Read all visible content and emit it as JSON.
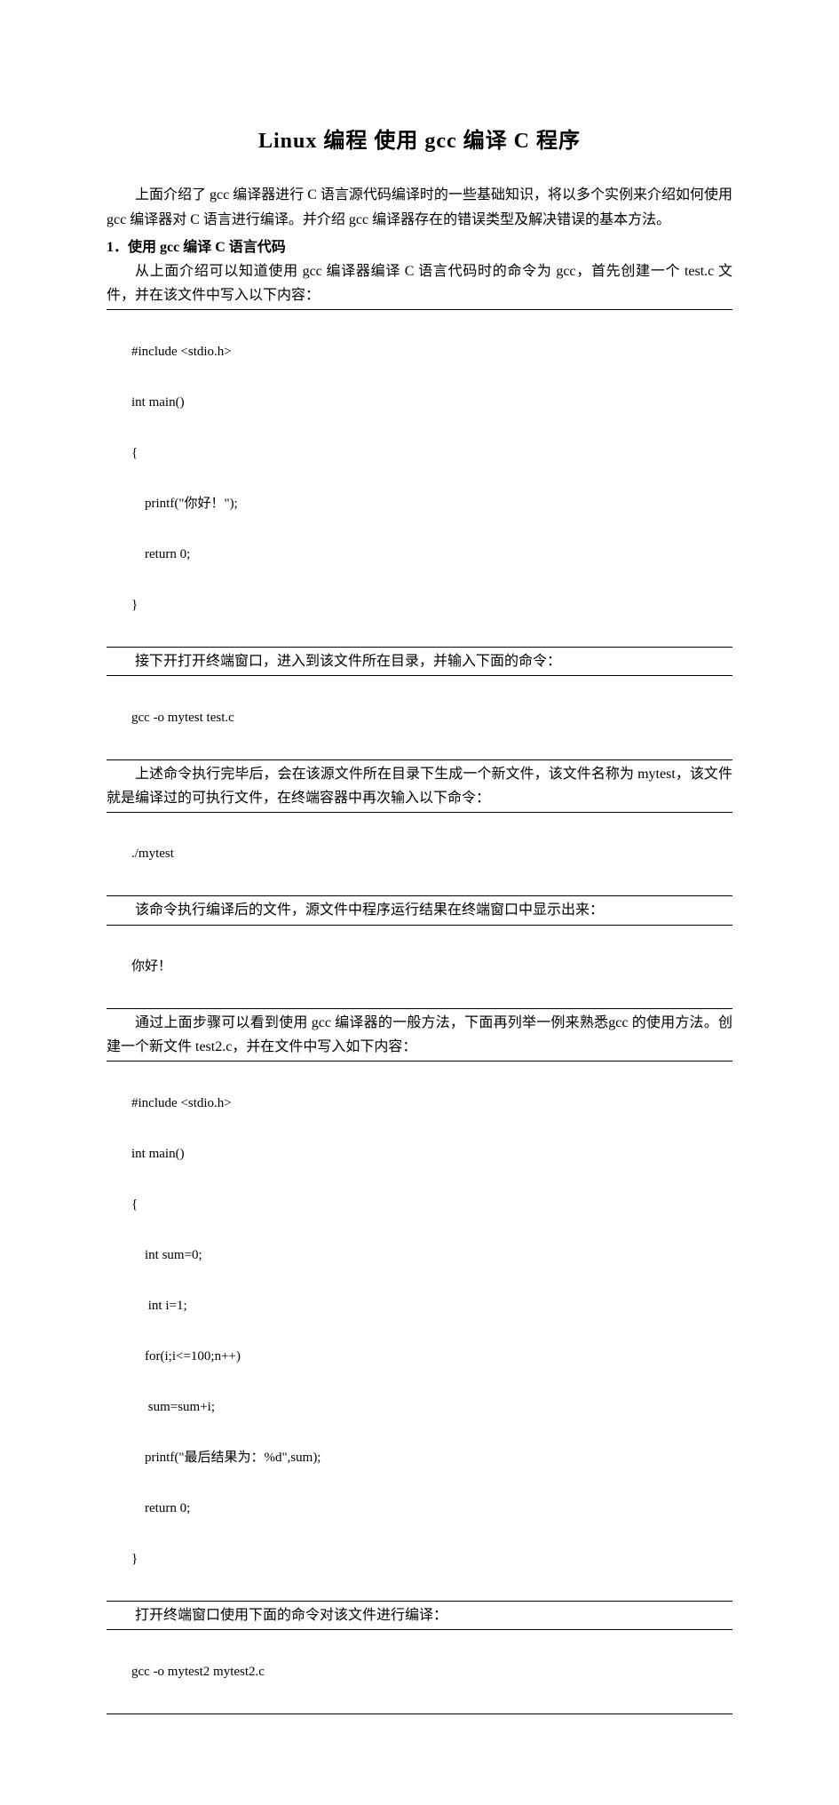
{
  "title": "Linux 编程   使用 gcc 编译 C 程序",
  "intro": "上面介绍了 gcc 编译器进行 C 语言源代码编译时的一些基础知识，将以多个实例来介绍如何使用 gcc 编译器对 C 语言进行编译。并介绍 gcc 编译器存在的错误类型及解决错误的基本方法。",
  "section1_heading": "1．使用 gcc 编译 C 语言代码",
  "section1_p1": "从上面介绍可以知道使用 gcc 编译器编译 C 语言代码时的命令为 gcc，首先创建一个 test.c 文件，并在该文件中写入以下内容：",
  "code1": {
    "l0": "#include <stdio.h>",
    "l1": "int main()",
    "l2": "{",
    "l3": "    printf(\"你好！\");",
    "l4": "    return 0;",
    "l5": "}"
  },
  "section1_p2": "接下开打开终端窗口，进入到该文件所在目录，并输入下面的命令：",
  "code2": "gcc -o mytest test.c",
  "section1_p3": "上述命令执行完毕后，会在该源文件所在目录下生成一个新文件，该文件名称为 mytest，该文件就是编译过的可执行文件，在终端容器中再次输入以下命令：",
  "code3": "./mytest",
  "section1_p4": "该命令执行编译后的文件，源文件中程序运行结果在终端窗口中显示出来：",
  "code4": "你好！",
  "section1_p5": "通过上面步骤可以看到使用 gcc 编译器的一般方法，下面再列举一例来熟悉gcc 的使用方法。创建一个新文件 test2.c，并在文件中写入如下内容：",
  "code5": {
    "l0": "#include <stdio.h>",
    "l1": "int main()",
    "l2": "{",
    "l3": "    int sum=0;",
    "l4": "     int i=1;",
    "l5": "    for(i;i<=100;n++)",
    "l6": "     sum=sum+i;",
    "l7": "    printf(\"最后结果为：%d\",sum);",
    "l8": "    return 0;",
    "l9": "}"
  },
  "section1_p6": "打开终端窗口使用下面的命令对该文件进行编译：",
  "code6": "gcc -o mytest2 mytest2.c"
}
